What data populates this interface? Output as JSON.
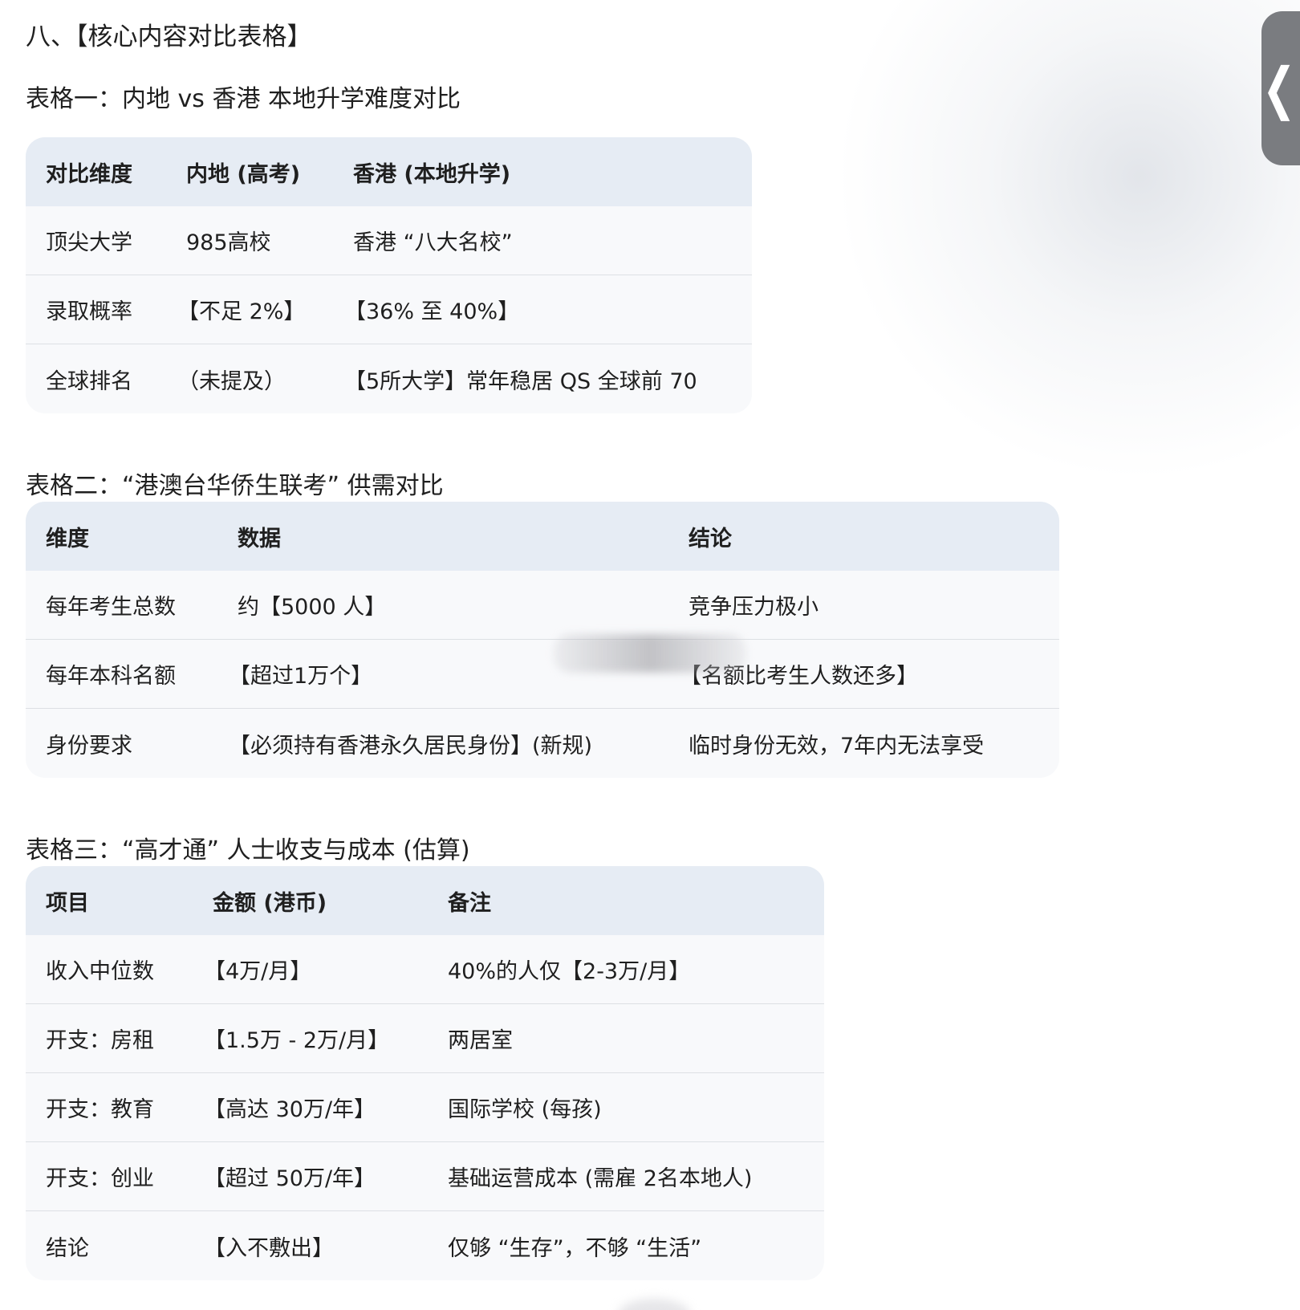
{
  "heading": "八、【核心内容对比表格】",
  "side_handle_glyph": "❮",
  "table1": {
    "title": "表格一：内地 vs 香港 本地升学难度对比",
    "headers": [
      "对比维度",
      "内地 (高考)",
      "香港 (本地升学)"
    ],
    "rows": [
      [
        "顶尖大学",
        "985高校",
        "香港 “八大名校”"
      ],
      [
        "录取概率",
        "【不足 2%】",
        "【36% 至 40%】"
      ],
      [
        "全球排名",
        "（未提及）",
        "【5所大学】常年稳居 QS 全球前 70"
      ]
    ]
  },
  "table2": {
    "title": "表格二：“港澳台华侨生联考” 供需对比",
    "headers": [
      "维度",
      "数据",
      "结论"
    ],
    "rows": [
      [
        "每年考生总数",
        "约【5000 人】",
        "竞争压力极小"
      ],
      [
        "每年本科名额",
        "【超过1万个】",
        "【名额比考生人数还多】"
      ],
      [
        "身份要求",
        "【必须持有香港永久居民身份】(新规)",
        "临时身份无效，7年内无法享受"
      ]
    ]
  },
  "table3": {
    "title": "表格三：“高才通” 人士收支与成本 (估算)",
    "headers": [
      "项目",
      "金额 (港币)",
      "备注"
    ],
    "rows": [
      [
        "收入中位数",
        "【4万/月】",
        "40%的人仅【2-3万/月】"
      ],
      [
        "开支：房租",
        "【1.5万 - 2万/月】",
        "两居室"
      ],
      [
        "开支：教育",
        "【高达 30万/年】",
        "国际学校 (每孩)"
      ],
      [
        "开支：创业",
        "【超过 50万/年】",
        "基础运营成本 (需雇 2名本地人)"
      ],
      [
        "结论",
        "【入不敷出】",
        "仅够 “生存”，不够 “生活”"
      ]
    ]
  }
}
